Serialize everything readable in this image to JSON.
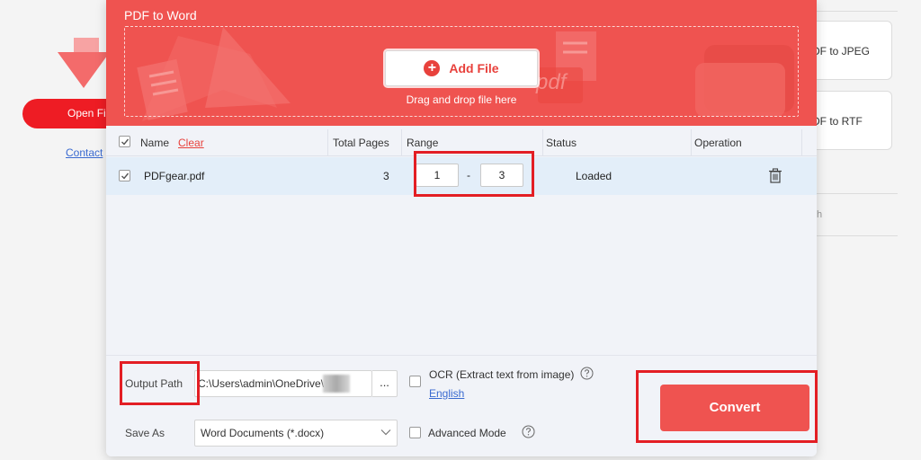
{
  "background": {
    "open_button": "Open Fi",
    "contact_link": "Contact",
    "cards": [
      "DF to JPEG",
      "DF to RTF"
    ],
    "partial_text": "h"
  },
  "dialog": {
    "title": "PDF to Word",
    "add_file_label": "Add File",
    "drop_hint": "Drag and drop file here",
    "deco_text": "pdf"
  },
  "table": {
    "headers": {
      "name": "Name",
      "clear": "Clear",
      "total_pages": "Total Pages",
      "range": "Range",
      "status": "Status",
      "operation": "Operation"
    },
    "rows": [
      {
        "file": "PDFgear.pdf",
        "total_pages": "3",
        "range_from": "1",
        "range_sep": "-",
        "range_to": "3",
        "status": "Loaded"
      }
    ]
  },
  "bottom": {
    "output_path_label": "Output Path",
    "output_path_value": "C:\\Users\\admin\\OneDrive\\",
    "browse_label": "...",
    "save_as_label": "Save As",
    "save_as_value": "Word Documents (*.docx)",
    "ocr_label": "OCR (Extract text from image)",
    "ocr_language": "English",
    "advanced_label": "Advanced Mode",
    "convert_label": "Convert"
  },
  "colors": {
    "accent": "#ef5350",
    "highlight": "#e31e24",
    "link": "#3a6ad0",
    "row_selected": "#e3eef9"
  },
  "icons": [
    "plus-icon",
    "checkbox-checked-icon",
    "trash-icon",
    "help-circle-icon",
    "chevron-down-icon",
    "file-arrow-decor-icon"
  ]
}
